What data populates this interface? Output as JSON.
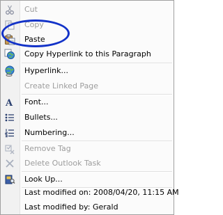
{
  "menu": {
    "cut": "Cut",
    "copy": "Copy",
    "paste": "Paste",
    "copy_hyperlink": "Copy Hyperlink to this Paragraph",
    "hyperlink": "Hyperlink...",
    "create_linked_page": "Create Linked Page",
    "font": "Font...",
    "bullets": "Bullets...",
    "numbering": "Numbering...",
    "remove_tag": "Remove Tag",
    "delete_outlook_task": "Delete Outlook Task",
    "look_up": "Look Up...",
    "last_modified_on": "Last modified on: 2008/04/20, 11:15 AM",
    "last_modified_by": "Last modified by: Gerald"
  },
  "colors": {
    "highlight_circle": "#1232c8",
    "disabled_text": "#9d9d9d"
  },
  "icons": {
    "cut": "scissors-icon",
    "copy": "copy-icon",
    "paste": "paste-icon",
    "copy_hyperlink": "globe-link-icon",
    "hyperlink": "globe-chain-icon",
    "font": "font-icon",
    "bullets": "bullets-icon",
    "numbering": "numbering-icon",
    "remove_tag": "remove-tag-icon",
    "delete_task": "delete-x-icon",
    "look_up": "book-icon"
  }
}
